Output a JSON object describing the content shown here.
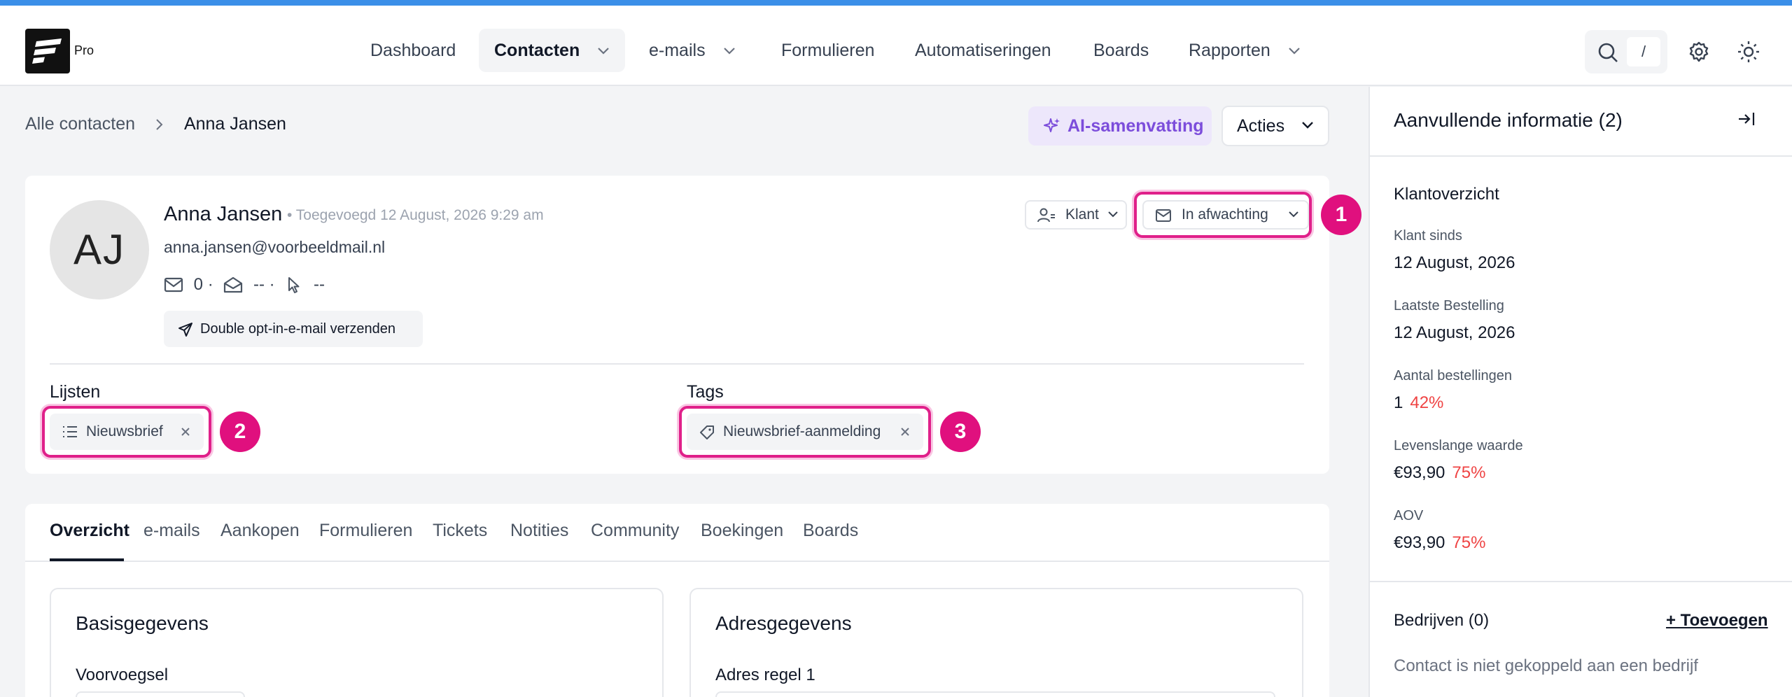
{
  "nav": {
    "logo_label": "Pro",
    "items": [
      {
        "label": "Dashboard"
      },
      {
        "label": "Contacten"
      },
      {
        "label": "e-mails"
      },
      {
        "label": "Formulieren"
      },
      {
        "label": "Automatiseringen"
      },
      {
        "label": "Boards"
      },
      {
        "label": "Rapporten"
      }
    ],
    "search_shortcut": "/"
  },
  "breadcrumb": {
    "parent": "Alle contacten",
    "current": "Anna Jansen"
  },
  "header_actions": {
    "ai_summary": "AI-samenvatting",
    "actions": "Acties"
  },
  "contact": {
    "initials": "AJ",
    "name": "Anna Jansen",
    "added": "• Toegevoegd 12 August, 2026 9:29 am",
    "email": "anna.jansen@voorbeeldmail.nl",
    "stats": {
      "sent": "0 ·",
      "opened": "-- ·",
      "clicked": "--"
    },
    "optin_button": "Double opt-in-e-mail verzenden",
    "type": "Klant",
    "status": "In afwachting",
    "lists_label": "Lijsten",
    "lists": [
      "Nieuwsbrief"
    ],
    "tags_label": "Tags",
    "tags": [
      "Nieuwsbrief-aanmelding"
    ]
  },
  "callouts": [
    "1",
    "2",
    "3"
  ],
  "tabs": [
    "Overzicht",
    "e-mails",
    "Aankopen",
    "Formulieren",
    "Tickets",
    "Notities",
    "Community",
    "Boekingen",
    "Boards"
  ],
  "basic": {
    "title": "Basisgegevens",
    "field1": "Voorvoegsel"
  },
  "address": {
    "title": "Adresgegevens",
    "field1": "Adres regel 1"
  },
  "side": {
    "title": "Aanvullende informatie (2)",
    "section": "Klantoverzicht",
    "items": [
      {
        "label": "Klant sinds",
        "value": "12 August, 2026",
        "pct": ""
      },
      {
        "label": "Laatste Bestelling",
        "value": "12 August, 2026",
        "pct": ""
      },
      {
        "label": "Aantal bestellingen",
        "value": "1",
        "pct": "42%"
      },
      {
        "label": "Levenslange waarde",
        "value": "€93,90",
        "pct": "75%"
      },
      {
        "label": "AOV",
        "value": "€93,90",
        "pct": "75%"
      }
    ],
    "companies": "Bedrijven (0)",
    "add_company": "+ Toevoegen",
    "no_company": "Contact is niet gekoppeld aan een bedrijf"
  },
  "colors": {
    "accent_top": "#3b8fe8",
    "ai_purple": "#7c4ddb",
    "callout_pink": "#e0107e",
    "pct_red": "#ef4444"
  }
}
